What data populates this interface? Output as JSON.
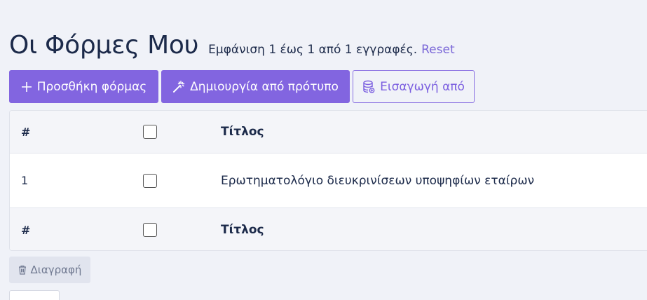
{
  "header": {
    "title": "Οι Φόρμες Μου",
    "summary": "Εμφάνιση 1 έως 1 από 1 εγγραφές.",
    "reset_label": "Reset"
  },
  "toolbar": {
    "add_form_label": "Προσθήκη φόρμας",
    "create_from_template_label": "Δημιουργία από πρότυπο",
    "import_label": "Εισαγωγή από"
  },
  "table": {
    "columns": [
      "#",
      "",
      "Τίτλος"
    ],
    "header": {
      "num": "#",
      "title": "Τίτλος"
    },
    "rows": [
      {
        "num": "1",
        "title": "Ερωτηματολόγιο διευκρινίσεων υποψηφίων εταίρων"
      }
    ],
    "footer": {
      "num": "#",
      "title": "Τίτλος"
    }
  },
  "actions": {
    "delete_label": "Διαγραφή"
  },
  "colors": {
    "accent": "#8265e0",
    "background": "#f0f2f8",
    "text": "#1c2a4a",
    "link": "#7b68d8"
  }
}
